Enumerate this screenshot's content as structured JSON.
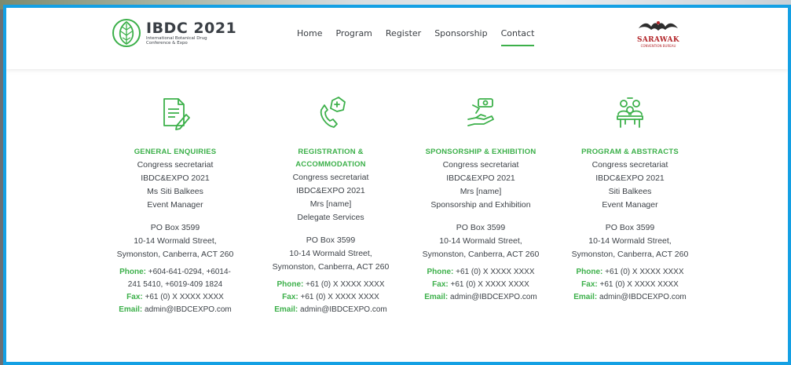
{
  "header": {
    "logo": {
      "title": "IBDC 2021",
      "subtitle": "International Botanical Drug Conference & Expo"
    },
    "nav": [
      "Home",
      "Program",
      "Register",
      "Sponsorship",
      "Contact"
    ],
    "active_nav": "Contact",
    "partner": {
      "name": "SARAWAK",
      "sub": "CONVENTION BUREAU"
    }
  },
  "columns": [
    {
      "icon": "document-edit-icon",
      "title": [
        "GENERAL ENQUIRIES"
      ],
      "lines": [
        "Congress secretariat",
        "IBDC&EXPO 2021",
        "Ms Siti Balkees",
        "Event Manager"
      ],
      "address": [
        "PO Box 3599",
        "10-14 Wormald Street,",
        "Symonston, Canberra, ACT 260"
      ],
      "phone_label": "Phone:",
      "phone": "+604-641-0294, +6014-241 5410, +6019-409 1824",
      "fax_label": "Fax:",
      "fax": "+61 (0) X XXXX XXXX",
      "email_label": "Email:",
      "email": "admin@IBDCEXPO.com"
    },
    {
      "icon": "phone-call-icon",
      "title": [
        "REGISTRATION &",
        "ACCOMMODATION"
      ],
      "lines": [
        "Congress secretariat",
        "IBDC&EXPO 2021",
        "Mrs [name]",
        "Delegate Services"
      ],
      "address": [
        "PO Box 3599",
        "10-14 Wormald Street,",
        "Symonston, Canberra, ACT 260"
      ],
      "phone_label": "Phone:",
      "phone": "+61 (0) X XXXX XXXX",
      "fax_label": "Fax:",
      "fax": "+61 (0) X XXXX XXXX",
      "email_label": "Email:",
      "email": "admin@IBDCEXPO.com"
    },
    {
      "icon": "handshake-money-icon",
      "title": [
        "SPONSORSHIP & EXHIBITION"
      ],
      "lines": [
        "Congress secretariat",
        "IBDC&EXPO 2021",
        "Mrs [name]",
        "Sponsorship and Exhibition"
      ],
      "address": [
        "PO Box 3599",
        "10-14 Wormald Street,",
        "Symonston, Canberra, ACT 260"
      ],
      "phone_label": "Phone:",
      "phone": "+61 (0) X XXXX XXXX",
      "fax_label": "Fax:",
      "fax": "+61 (0) X XXXX XXXX",
      "email_label": "Email:",
      "email": "admin@IBDCEXPO.com"
    },
    {
      "icon": "meeting-group-icon",
      "title": [
        "PROGRAM & ABSTRACTS"
      ],
      "lines": [
        "Congress secretariat",
        "IBDC&EXPO 2021",
        "Siti Balkees",
        "Event Manager"
      ],
      "address": [
        "PO Box 3599",
        "10-14 Wormald Street,",
        "Symonston, Canberra, ACT 260"
      ],
      "phone_label": "Phone:",
      "phone": "+61 (0) X XXXX XXXX",
      "fax_label": "Fax:",
      "fax": "+61 (0) X XXXX XXXX",
      "email_label": "Email:",
      "email": "admin@IBDCEXPO.com"
    }
  ],
  "colors": {
    "frame": "#14a0e4",
    "accent": "#3cb04a",
    "text": "#3d4248"
  }
}
